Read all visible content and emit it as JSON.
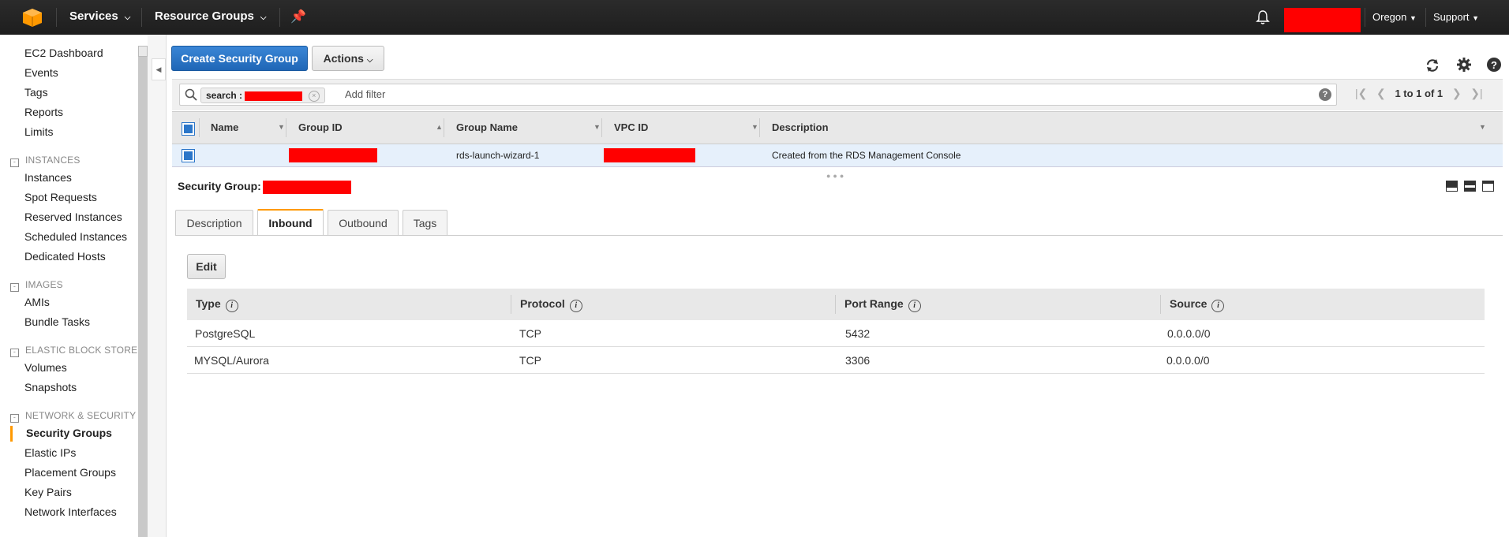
{
  "topnav": {
    "services_label": "Services",
    "resource_groups_label": "Resource Groups",
    "region_label": "Oregon",
    "support_label": "Support"
  },
  "sidebar": {
    "top_links": [
      "EC2 Dashboard",
      "Events",
      "Tags",
      "Reports",
      "Limits"
    ],
    "sections": [
      {
        "title": "INSTANCES",
        "items": [
          "Instances",
          "Spot Requests",
          "Reserved Instances",
          "Scheduled Instances",
          "Dedicated Hosts"
        ]
      },
      {
        "title": "IMAGES",
        "items": [
          "AMIs",
          "Bundle Tasks"
        ]
      },
      {
        "title": "ELASTIC BLOCK STORE",
        "items": [
          "Volumes",
          "Snapshots"
        ]
      },
      {
        "title": "NETWORK & SECURITY",
        "items": [
          "Security Groups",
          "Elastic IPs",
          "Placement Groups",
          "Key Pairs",
          "Network Interfaces"
        ]
      }
    ],
    "active_item": "Security Groups"
  },
  "toolbar": {
    "create_label": "Create Security Group",
    "actions_label": "Actions"
  },
  "filter": {
    "token_label": "search",
    "token_sep": ":",
    "add_filter_placeholder": "Add filter",
    "pagination": "1 to 1 of 1"
  },
  "table": {
    "columns": [
      "Name",
      "Group ID",
      "Group Name",
      "VPC ID",
      "Description"
    ],
    "rows": [
      {
        "name": "",
        "group_name": "rds-launch-wizard-1",
        "description": "Created from the RDS Management Console"
      }
    ]
  },
  "details": {
    "title_prefix": "Security Group:",
    "tabs": [
      "Description",
      "Inbound",
      "Outbound",
      "Tags"
    ],
    "active_tab": "Inbound",
    "edit_label": "Edit",
    "rules_columns": [
      "Type",
      "Protocol",
      "Port Range",
      "Source"
    ],
    "rules": [
      {
        "type": "PostgreSQL",
        "protocol": "TCP",
        "port": "5432",
        "source": "0.0.0.0/0"
      },
      {
        "type": "MYSQL/Aurora",
        "protocol": "TCP",
        "port": "3306",
        "source": "0.0.0.0/0"
      }
    ]
  },
  "colors": {
    "nav_bg": "#232323",
    "primary": "#2b76c9",
    "accent": "#ff9900",
    "redaction": "#ff0000"
  }
}
